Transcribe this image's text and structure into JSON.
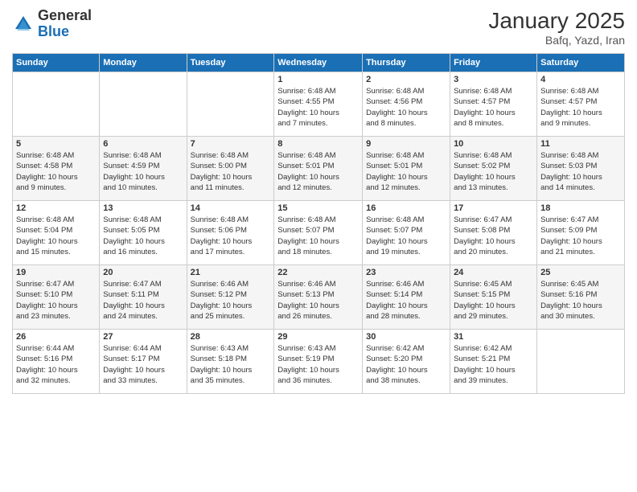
{
  "logo": {
    "general": "General",
    "blue": "Blue"
  },
  "title": "January 2025",
  "subtitle": "Bafq, Yazd, Iran",
  "header_days": [
    "Sunday",
    "Monday",
    "Tuesday",
    "Wednesday",
    "Thursday",
    "Friday",
    "Saturday"
  ],
  "weeks": [
    [
      {
        "day": "",
        "info": ""
      },
      {
        "day": "",
        "info": ""
      },
      {
        "day": "",
        "info": ""
      },
      {
        "day": "1",
        "info": "Sunrise: 6:48 AM\nSunset: 4:55 PM\nDaylight: 10 hours\nand 7 minutes."
      },
      {
        "day": "2",
        "info": "Sunrise: 6:48 AM\nSunset: 4:56 PM\nDaylight: 10 hours\nand 8 minutes."
      },
      {
        "day": "3",
        "info": "Sunrise: 6:48 AM\nSunset: 4:57 PM\nDaylight: 10 hours\nand 8 minutes."
      },
      {
        "day": "4",
        "info": "Sunrise: 6:48 AM\nSunset: 4:57 PM\nDaylight: 10 hours\nand 9 minutes."
      }
    ],
    [
      {
        "day": "5",
        "info": "Sunrise: 6:48 AM\nSunset: 4:58 PM\nDaylight: 10 hours\nand 9 minutes."
      },
      {
        "day": "6",
        "info": "Sunrise: 6:48 AM\nSunset: 4:59 PM\nDaylight: 10 hours\nand 10 minutes."
      },
      {
        "day": "7",
        "info": "Sunrise: 6:48 AM\nSunset: 5:00 PM\nDaylight: 10 hours\nand 11 minutes."
      },
      {
        "day": "8",
        "info": "Sunrise: 6:48 AM\nSunset: 5:01 PM\nDaylight: 10 hours\nand 12 minutes."
      },
      {
        "day": "9",
        "info": "Sunrise: 6:48 AM\nSunset: 5:01 PM\nDaylight: 10 hours\nand 12 minutes."
      },
      {
        "day": "10",
        "info": "Sunrise: 6:48 AM\nSunset: 5:02 PM\nDaylight: 10 hours\nand 13 minutes."
      },
      {
        "day": "11",
        "info": "Sunrise: 6:48 AM\nSunset: 5:03 PM\nDaylight: 10 hours\nand 14 minutes."
      }
    ],
    [
      {
        "day": "12",
        "info": "Sunrise: 6:48 AM\nSunset: 5:04 PM\nDaylight: 10 hours\nand 15 minutes."
      },
      {
        "day": "13",
        "info": "Sunrise: 6:48 AM\nSunset: 5:05 PM\nDaylight: 10 hours\nand 16 minutes."
      },
      {
        "day": "14",
        "info": "Sunrise: 6:48 AM\nSunset: 5:06 PM\nDaylight: 10 hours\nand 17 minutes."
      },
      {
        "day": "15",
        "info": "Sunrise: 6:48 AM\nSunset: 5:07 PM\nDaylight: 10 hours\nand 18 minutes."
      },
      {
        "day": "16",
        "info": "Sunrise: 6:48 AM\nSunset: 5:07 PM\nDaylight: 10 hours\nand 19 minutes."
      },
      {
        "day": "17",
        "info": "Sunrise: 6:47 AM\nSunset: 5:08 PM\nDaylight: 10 hours\nand 20 minutes."
      },
      {
        "day": "18",
        "info": "Sunrise: 6:47 AM\nSunset: 5:09 PM\nDaylight: 10 hours\nand 21 minutes."
      }
    ],
    [
      {
        "day": "19",
        "info": "Sunrise: 6:47 AM\nSunset: 5:10 PM\nDaylight: 10 hours\nand 23 minutes."
      },
      {
        "day": "20",
        "info": "Sunrise: 6:47 AM\nSunset: 5:11 PM\nDaylight: 10 hours\nand 24 minutes."
      },
      {
        "day": "21",
        "info": "Sunrise: 6:46 AM\nSunset: 5:12 PM\nDaylight: 10 hours\nand 25 minutes."
      },
      {
        "day": "22",
        "info": "Sunrise: 6:46 AM\nSunset: 5:13 PM\nDaylight: 10 hours\nand 26 minutes."
      },
      {
        "day": "23",
        "info": "Sunrise: 6:46 AM\nSunset: 5:14 PM\nDaylight: 10 hours\nand 28 minutes."
      },
      {
        "day": "24",
        "info": "Sunrise: 6:45 AM\nSunset: 5:15 PM\nDaylight: 10 hours\nand 29 minutes."
      },
      {
        "day": "25",
        "info": "Sunrise: 6:45 AM\nSunset: 5:16 PM\nDaylight: 10 hours\nand 30 minutes."
      }
    ],
    [
      {
        "day": "26",
        "info": "Sunrise: 6:44 AM\nSunset: 5:16 PM\nDaylight: 10 hours\nand 32 minutes."
      },
      {
        "day": "27",
        "info": "Sunrise: 6:44 AM\nSunset: 5:17 PM\nDaylight: 10 hours\nand 33 minutes."
      },
      {
        "day": "28",
        "info": "Sunrise: 6:43 AM\nSunset: 5:18 PM\nDaylight: 10 hours\nand 35 minutes."
      },
      {
        "day": "29",
        "info": "Sunrise: 6:43 AM\nSunset: 5:19 PM\nDaylight: 10 hours\nand 36 minutes."
      },
      {
        "day": "30",
        "info": "Sunrise: 6:42 AM\nSunset: 5:20 PM\nDaylight: 10 hours\nand 38 minutes."
      },
      {
        "day": "31",
        "info": "Sunrise: 6:42 AM\nSunset: 5:21 PM\nDaylight: 10 hours\nand 39 minutes."
      },
      {
        "day": "",
        "info": ""
      }
    ]
  ]
}
